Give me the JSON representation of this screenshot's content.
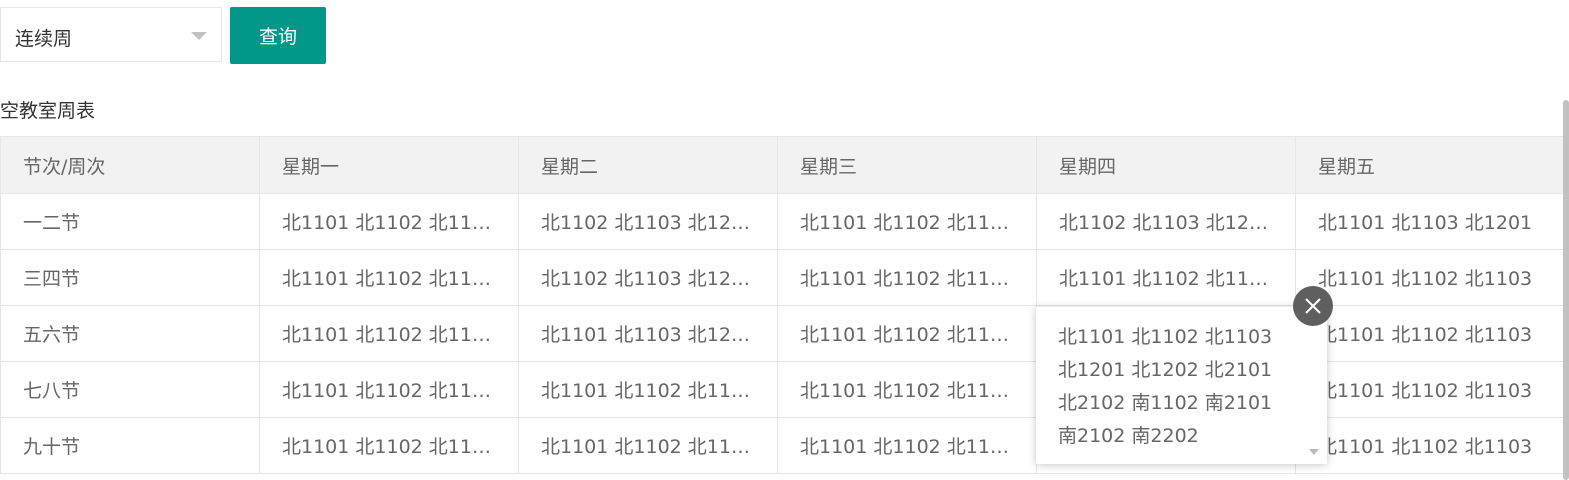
{
  "filter": {
    "selected": "连续周",
    "query_label": "查询"
  },
  "table_title": "空教室周表",
  "table": {
    "headers": [
      "节次/周次",
      "星期一",
      "星期二",
      "星期三",
      "星期四",
      "星期五"
    ],
    "rows": [
      [
        "一二节",
        "北1101 北1102 北11…",
        "北1102 北1103 北12…",
        "北1101 北1102 北11…",
        "北1102 北1103 北12…",
        "北1101 北1103 北1201"
      ],
      [
        "三四节",
        "北1101 北1102 北11…",
        "北1102 北1103 北12…",
        "北1101 北1102 北11…",
        "北1101 北1102 北11…",
        "北1101 北1102 北1103"
      ],
      [
        "五六节",
        "北1101 北1102 北11…",
        "北1101 北1103 北12…",
        "北1101 北1102 北11…",
        "",
        "北1101 北1102 北1103"
      ],
      [
        "七八节",
        "北1101 北1102 北11…",
        "北1101 北1102 北11…",
        "北1101 北1102 北11…",
        "",
        "北1101 北1102 北1103"
      ],
      [
        "九十节",
        "北1101 北1102 北11…",
        "北1101 北1102 北11…",
        "北1101 北1102 北11…",
        "",
        "北1101 北1102 北1103"
      ]
    ]
  },
  "popup": {
    "text": "北1101 北1102 北1103 北1201 北1202 北2101 北2102 南1102 南2101 南2102 南2202"
  },
  "icons": {
    "select_caret": "caret-down-icon",
    "popup_close": "close-icon",
    "popup_scroll": "scroll-down-icon"
  },
  "colors": {
    "primary": "#009688",
    "header_bg": "#f2f2f2",
    "border": "#e6e6e6",
    "close_bg": "#5f5f5f"
  }
}
